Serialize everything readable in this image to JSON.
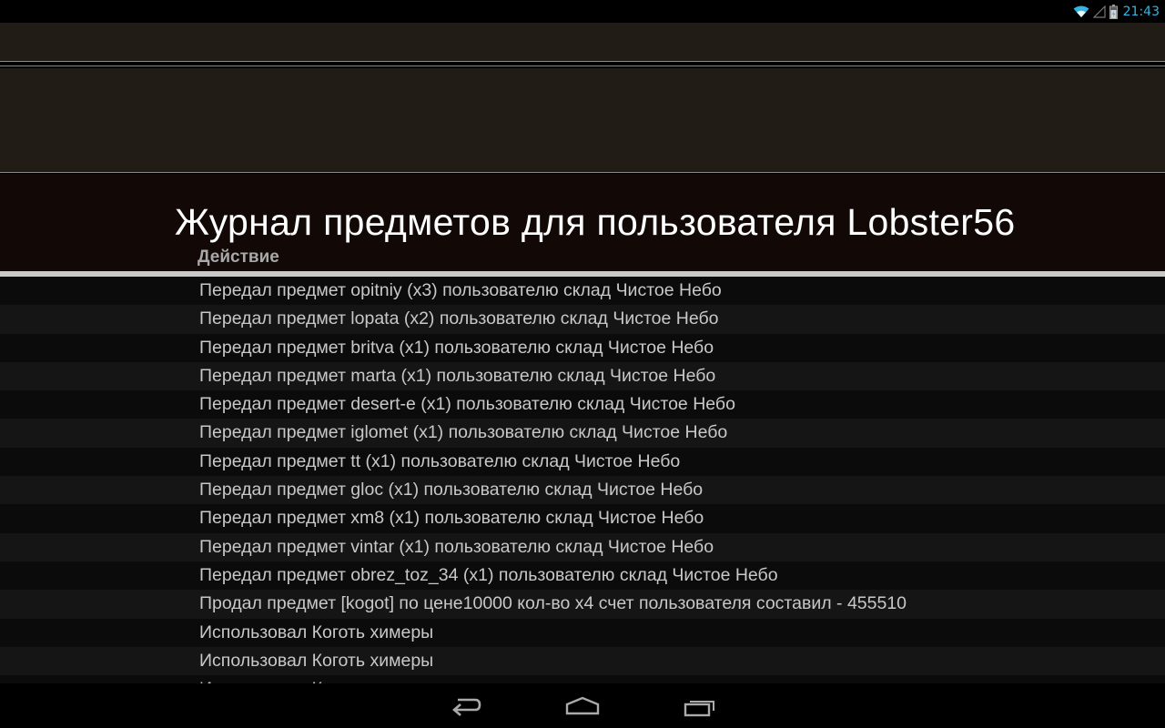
{
  "status_bar": {
    "time": "21:43",
    "icons": [
      "wifi-icon",
      "signal-icon",
      "battery-icon"
    ],
    "accent_color": "#33b5e5"
  },
  "page": {
    "title": "Журнал предметов для пользователя Lobster56",
    "column_header": "Действие"
  },
  "log": {
    "rows": [
      "Передал предмет opitniy (x3) пользователю склад Чистое Небо",
      "Передал предмет lopata (x2) пользователю склад Чистое Небо",
      "Передал предмет britva (x1) пользователю склад Чистое Небо",
      "Передал предмет marta (x1) пользователю склад Чистое Небо",
      "Передал предмет desert-e (x1) пользователю склад Чистое Небо",
      "Передал предмет iglomet (x1) пользователю склад Чистое Небо",
      "Передал предмет tt (x1) пользователю склад Чистое Небо",
      "Передал предмет gloc (x1) пользователю склад Чистое Небо",
      "Передал предмет xm8 (x1) пользователю склад Чистое Небо",
      "Передал предмет vintar (x1) пользователю склад Чистое Небо",
      "Передал предмет obrez_toz_34 (x1) пользователю склад Чистое Небо",
      "Продал предмет [kogot] по цене10000 кол-во х4 счет пользователя составил - 455510",
      "Использовал Коготь химеры",
      "Использовал Коготь химеры",
      "Использовал Коготь химеры"
    ]
  },
  "nav_bar": {
    "buttons": [
      "back-icon",
      "home-icon",
      "recent-apps-icon"
    ]
  }
}
